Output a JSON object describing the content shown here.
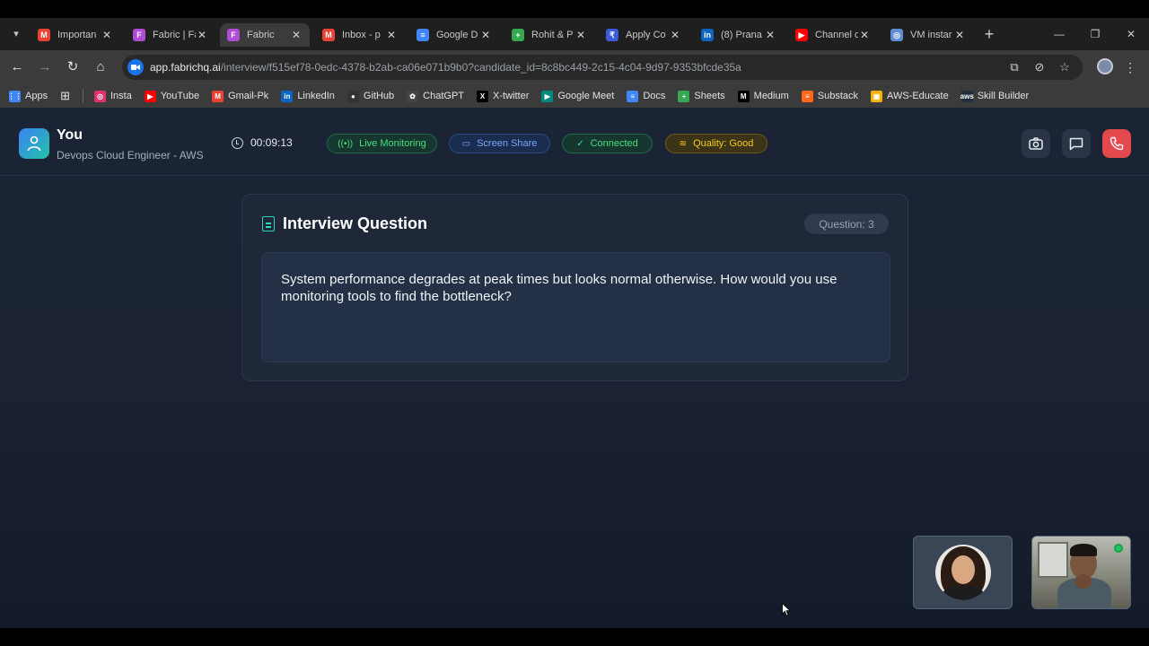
{
  "browser": {
    "tabs": [
      {
        "label": "Importan",
        "icon": "gmail-icon",
        "color": "#ea4335",
        "glyph": "M"
      },
      {
        "label": "Fabric | Fa",
        "icon": "fabric-icon",
        "color": "#b04bd6",
        "glyph": "F"
      },
      {
        "label": "Fabric",
        "icon": "fabric-icon",
        "color": "#b04bd6",
        "glyph": "F",
        "active": true
      },
      {
        "label": "Inbox - p",
        "icon": "gmail-icon",
        "color": "#ea4335",
        "glyph": "M"
      },
      {
        "label": "Google D",
        "icon": "google-docs-icon",
        "color": "#4285f4",
        "glyph": "≡"
      },
      {
        "label": "Rohit & P",
        "icon": "google-sheets-icon",
        "color": "#34a853",
        "glyph": "+"
      },
      {
        "label": "Apply Co",
        "icon": "apply-icon",
        "color": "#3b5bdb",
        "glyph": "₹"
      },
      {
        "label": "(8) Prana",
        "icon": "linkedin-icon",
        "color": "#0a66c2",
        "glyph": "in"
      },
      {
        "label": "Channel d",
        "icon": "youtube-icon",
        "color": "#ff0000",
        "glyph": "▶"
      },
      {
        "label": "VM instar",
        "icon": "gcp-icon",
        "color": "#5f8dd3",
        "glyph": "◎"
      }
    ],
    "url_host": "app.fabrichq.ai",
    "url_path": "/interview/f515ef78-0edc-4378-b2ab-ca06e071b9b0?candidate_id=8c8bc449-2c15-4c04-9d97-9353bfcde35a",
    "bookmarks": [
      {
        "label": "Apps",
        "icon": "apps-grid-icon",
        "color": "#4285f4",
        "glyph": "⋮⋮"
      },
      {
        "label": "Insta",
        "icon": "instagram-icon",
        "color": "#e1306c",
        "glyph": "◎"
      },
      {
        "label": "YouTube",
        "icon": "youtube-icon",
        "color": "#ff0000",
        "glyph": "▶"
      },
      {
        "label": "Gmail-Pk",
        "icon": "gmail-icon",
        "color": "#ea4335",
        "glyph": "M"
      },
      {
        "label": "LinkedIn",
        "icon": "linkedin-icon",
        "color": "#0a66c2",
        "glyph": "in"
      },
      {
        "label": "GitHub",
        "icon": "github-icon",
        "color": "#333333",
        "glyph": "●"
      },
      {
        "label": "ChatGPT",
        "icon": "chatgpt-icon",
        "color": "#444444",
        "glyph": "✿"
      },
      {
        "label": "X-twitter",
        "icon": "x-icon",
        "color": "#000000",
        "glyph": "X"
      },
      {
        "label": "Google Meet",
        "icon": "google-meet-icon",
        "color": "#00897b",
        "glyph": "▶"
      },
      {
        "label": "Docs",
        "icon": "google-docs-icon",
        "color": "#4285f4",
        "glyph": "≡"
      },
      {
        "label": "Sheets",
        "icon": "google-sheets-icon",
        "color": "#34a853",
        "glyph": "+"
      },
      {
        "label": "Medium",
        "icon": "medium-icon",
        "color": "#000000",
        "glyph": "M"
      },
      {
        "label": "Substack",
        "icon": "substack-icon",
        "color": "#ff6719",
        "glyph": "≡"
      },
      {
        "label": "AWS-Educate",
        "icon": "aws-educate-icon",
        "color": "#f5b000",
        "glyph": "▣"
      },
      {
        "label": "Skill Builder",
        "icon": "aws-skill-builder-icon",
        "color": "#232f3e",
        "glyph": "aws"
      }
    ]
  },
  "header": {
    "user_name": "You",
    "user_role": "Devops Cloud Engineer - AWS",
    "timer": "00:09:13",
    "pills": {
      "live": "Live Monitoring",
      "share": "Screen Share",
      "connected": "Connected",
      "quality": "Quality: Good"
    }
  },
  "question": {
    "title": "Interview Question",
    "badge": "Question: 3",
    "text": "System performance degrades at peak times but looks normal otherwise. How would you use monitoring tools to find the bottleneck?"
  },
  "colors": {
    "accent_green": "#4ade80",
    "accent_blue": "#7aa7ff",
    "accent_yellow": "#facc15",
    "end_call": "#e5484d",
    "teal": "#2dd4bf"
  }
}
